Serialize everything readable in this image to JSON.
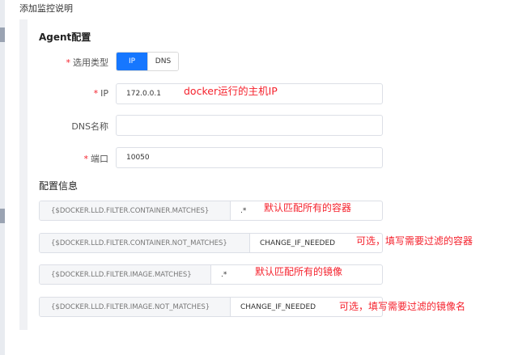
{
  "page": {
    "title": "添加监控说明"
  },
  "agent_section": {
    "title": "Agent配置",
    "type_field": {
      "required_mark": "*",
      "label": "选用类型",
      "options": [
        "IP",
        "DNS"
      ],
      "selected": "IP"
    },
    "ip_field": {
      "required_mark": "*",
      "label": "IP",
      "value": "172.0.0.1"
    },
    "dns_field": {
      "label": "DNS名称",
      "value": ""
    },
    "port_field": {
      "required_mark": "*",
      "label": "端口",
      "value": "10050"
    }
  },
  "config_section": {
    "title": "配置信息",
    "macros": [
      {
        "key": "{$DOCKER.LLD.FILTER.CONTAINER.MATCHES}",
        "value": ".*"
      },
      {
        "key": "{$DOCKER.LLD.FILTER.CONTAINER.NOT_MATCHES}",
        "value": "CHANGE_IF_NEEDED"
      },
      {
        "key": "{$DOCKER.LLD.FILTER.IMAGE.MATCHES}",
        "value": ".*"
      },
      {
        "key": "{$DOCKER.LLD.FILTER.IMAGE.NOT_MATCHES}",
        "value": "CHANGE_IF_NEEDED"
      }
    ]
  },
  "annotations": {
    "ip_note": "docker运行的主机IP",
    "macro1_note": "默认匹配所有的容器",
    "macro2_note": "可选，填写需要过滤的容器",
    "macro3_note": "默认匹配所有的镜像",
    "macro4_note": "可选，填写需要过滤的镜像名"
  },
  "colors": {
    "accent": "#1677ff",
    "required": "#f5222d",
    "annotation": "#f5222d"
  }
}
